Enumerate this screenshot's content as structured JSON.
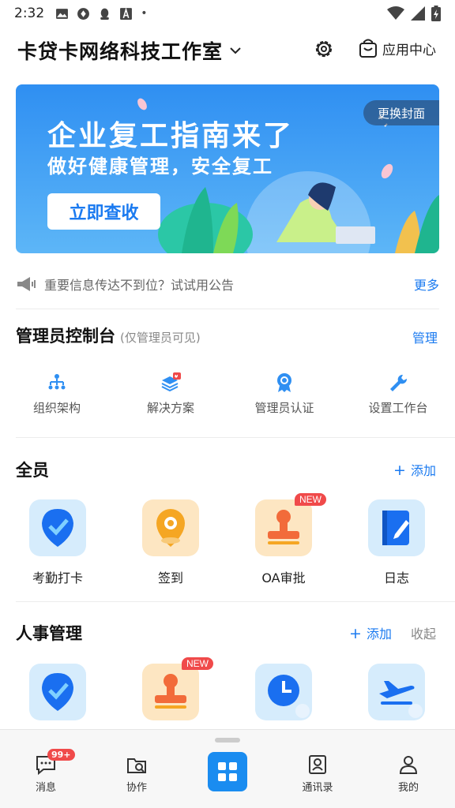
{
  "status_bar": {
    "time": "2:32"
  },
  "header": {
    "org_name": "卡贷卡网络科技工作室",
    "app_center_label": "应用中心"
  },
  "banner": {
    "headline": "企业复工指南来了",
    "subline": "做好健康管理，安全复工",
    "cta_label": "立即查收",
    "change_cover_label": "更换封面"
  },
  "notice": {
    "text": "重要信息传达不到位？试试用公告",
    "more_label": "更多"
  },
  "admin_console": {
    "title": "管理员控制台",
    "subtitle": "(仅管理员可见)",
    "manage_label": "管理",
    "items": [
      {
        "label": "组织架构",
        "icon": "org-chart-icon"
      },
      {
        "label": "解决方案",
        "icon": "solution-layers-icon"
      },
      {
        "label": "管理员认证",
        "icon": "certification-badge-icon"
      },
      {
        "label": "设置工作台",
        "icon": "wrench-icon"
      }
    ]
  },
  "all_staff": {
    "title": "全员",
    "add_label": "添加",
    "apps": [
      {
        "label": "考勤打卡",
        "icon": "check-shield-icon",
        "badge": ""
      },
      {
        "label": "签到",
        "icon": "location-pin-icon",
        "badge": ""
      },
      {
        "label": "OA审批",
        "icon": "stamp-icon",
        "badge": "NEW"
      },
      {
        "label": "日志",
        "icon": "notebook-pen-icon",
        "badge": ""
      }
    ]
  },
  "hr": {
    "title": "人事管理",
    "add_label": "添加",
    "collapse_label": "收起",
    "apps": [
      {
        "icon": "check-shield-icon",
        "badge": ""
      },
      {
        "icon": "stamp-icon",
        "badge": "NEW"
      },
      {
        "icon": "clock-icon",
        "badge": ""
      },
      {
        "icon": "airplane-icon",
        "badge": ""
      }
    ]
  },
  "bottom_nav": [
    {
      "label": "消息",
      "icon": "message-icon",
      "badge": "99+"
    },
    {
      "label": "协作",
      "icon": "collab-icon"
    },
    {
      "label": "",
      "icon": "grid-apps-icon"
    },
    {
      "label": "通讯录",
      "icon": "contacts-icon"
    },
    {
      "label": "我的",
      "icon": "profile-icon"
    }
  ],
  "colors": {
    "accent": "#1a7af0",
    "badge": "#f04a4a"
  }
}
